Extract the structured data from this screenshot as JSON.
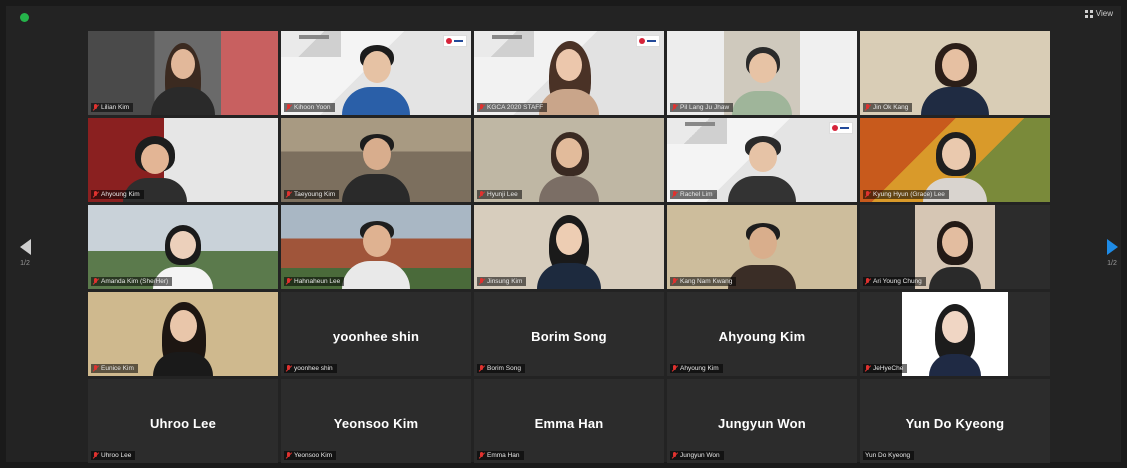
{
  "window": {
    "view_label": "View"
  },
  "navigation": {
    "left_page": "1/2",
    "right_page": "1/2"
  },
  "colors": {
    "active_speaker": "#b6e34a",
    "mic_muted": "#e0322f",
    "next_arrow": "#1e8be6"
  },
  "participants": [
    {
      "label": "Lilian Kim",
      "display": "",
      "video": true,
      "active": true
    },
    {
      "label": "Kihoon Yoon",
      "display": "",
      "video": true
    },
    {
      "label": "KGCA 2020 STAFF",
      "display": "",
      "video": true
    },
    {
      "label": "Pil Lang Ju Jhaw",
      "display": "",
      "video": true
    },
    {
      "label": "Jin Ok Kang",
      "display": "",
      "video": true
    },
    {
      "label": "Ahyoung Kim",
      "display": "",
      "video": true
    },
    {
      "label": "Taeyoung Kim",
      "display": "",
      "video": true
    },
    {
      "label": "Hyunji Lee",
      "display": "",
      "video": true
    },
    {
      "label": "Rachel Lim",
      "display": "",
      "video": true
    },
    {
      "label": "Kyung Hyun (Grace) Lee",
      "display": "",
      "video": true
    },
    {
      "label": "Amanda Kim (She/Her)",
      "display": "",
      "video": true
    },
    {
      "label": "Hahnaheun Lee",
      "display": "",
      "video": true
    },
    {
      "label": "Jinsung Kim",
      "display": "",
      "video": true
    },
    {
      "label": "Kang Nam Kwang",
      "display": "",
      "video": true
    },
    {
      "label": "Ari Young Chung",
      "display": "",
      "video": true
    },
    {
      "label": "Eunice Kim",
      "display": "",
      "video": true
    },
    {
      "label": "yoonhee shin",
      "display": "yoonhee shin",
      "video": false
    },
    {
      "label": "Borim Song",
      "display": "Borim Song",
      "video": false
    },
    {
      "label": "Ahyoung Kim",
      "display": "Ahyoung Kim",
      "video": false
    },
    {
      "label": "JeHyeChe",
      "display": "",
      "video": true
    },
    {
      "label": "Uhroo Lee",
      "display": "Uhroo Lee",
      "video": false
    },
    {
      "label": "Yeonsoo Kim",
      "display": "Yeonsoo Kim",
      "video": false
    },
    {
      "label": "Emma Han",
      "display": "Emma Han",
      "video": false
    },
    {
      "label": "Jungyun Won",
      "display": "Jungyun Won",
      "video": false
    },
    {
      "label": "Yun Do Kyeong",
      "display": "Yun Do Kyeong",
      "video": false
    }
  ]
}
